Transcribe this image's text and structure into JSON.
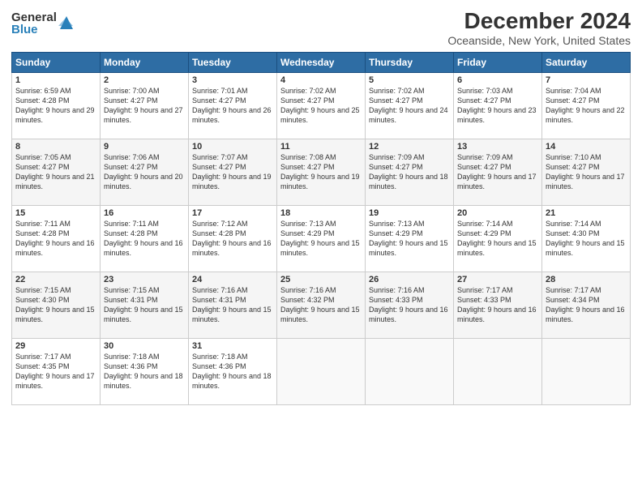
{
  "logo": {
    "general": "General",
    "blue": "Blue"
  },
  "title": "December 2024",
  "subtitle": "Oceanside, New York, United States",
  "header": {
    "days": [
      "Sunday",
      "Monday",
      "Tuesday",
      "Wednesday",
      "Thursday",
      "Friday",
      "Saturday"
    ]
  },
  "weeks": [
    [
      {
        "day": "1",
        "sunrise": "6:59 AM",
        "sunset": "4:28 PM",
        "daylight": "9 hours and 29 minutes."
      },
      {
        "day": "2",
        "sunrise": "7:00 AM",
        "sunset": "4:27 PM",
        "daylight": "9 hours and 27 minutes."
      },
      {
        "day": "3",
        "sunrise": "7:01 AM",
        "sunset": "4:27 PM",
        "daylight": "9 hours and 26 minutes."
      },
      {
        "day": "4",
        "sunrise": "7:02 AM",
        "sunset": "4:27 PM",
        "daylight": "9 hours and 25 minutes."
      },
      {
        "day": "5",
        "sunrise": "7:02 AM",
        "sunset": "4:27 PM",
        "daylight": "9 hours and 24 minutes."
      },
      {
        "day": "6",
        "sunrise": "7:03 AM",
        "sunset": "4:27 PM",
        "daylight": "9 hours and 23 minutes."
      },
      {
        "day": "7",
        "sunrise": "7:04 AM",
        "sunset": "4:27 PM",
        "daylight": "9 hours and 22 minutes."
      }
    ],
    [
      {
        "day": "8",
        "sunrise": "7:05 AM",
        "sunset": "4:27 PM",
        "daylight": "9 hours and 21 minutes."
      },
      {
        "day": "9",
        "sunrise": "7:06 AM",
        "sunset": "4:27 PM",
        "daylight": "9 hours and 20 minutes."
      },
      {
        "day": "10",
        "sunrise": "7:07 AM",
        "sunset": "4:27 PM",
        "daylight": "9 hours and 19 minutes."
      },
      {
        "day": "11",
        "sunrise": "7:08 AM",
        "sunset": "4:27 PM",
        "daylight": "9 hours and 19 minutes."
      },
      {
        "day": "12",
        "sunrise": "7:09 AM",
        "sunset": "4:27 PM",
        "daylight": "9 hours and 18 minutes."
      },
      {
        "day": "13",
        "sunrise": "7:09 AM",
        "sunset": "4:27 PM",
        "daylight": "9 hours and 17 minutes."
      },
      {
        "day": "14",
        "sunrise": "7:10 AM",
        "sunset": "4:27 PM",
        "daylight": "9 hours and 17 minutes."
      }
    ],
    [
      {
        "day": "15",
        "sunrise": "7:11 AM",
        "sunset": "4:28 PM",
        "daylight": "9 hours and 16 minutes."
      },
      {
        "day": "16",
        "sunrise": "7:11 AM",
        "sunset": "4:28 PM",
        "daylight": "9 hours and 16 minutes."
      },
      {
        "day": "17",
        "sunrise": "7:12 AM",
        "sunset": "4:28 PM",
        "daylight": "9 hours and 16 minutes."
      },
      {
        "day": "18",
        "sunrise": "7:13 AM",
        "sunset": "4:29 PM",
        "daylight": "9 hours and 15 minutes."
      },
      {
        "day": "19",
        "sunrise": "7:13 AM",
        "sunset": "4:29 PM",
        "daylight": "9 hours and 15 minutes."
      },
      {
        "day": "20",
        "sunrise": "7:14 AM",
        "sunset": "4:29 PM",
        "daylight": "9 hours and 15 minutes."
      },
      {
        "day": "21",
        "sunrise": "7:14 AM",
        "sunset": "4:30 PM",
        "daylight": "9 hours and 15 minutes."
      }
    ],
    [
      {
        "day": "22",
        "sunrise": "7:15 AM",
        "sunset": "4:30 PM",
        "daylight": "9 hours and 15 minutes."
      },
      {
        "day": "23",
        "sunrise": "7:15 AM",
        "sunset": "4:31 PM",
        "daylight": "9 hours and 15 minutes."
      },
      {
        "day": "24",
        "sunrise": "7:16 AM",
        "sunset": "4:31 PM",
        "daylight": "9 hours and 15 minutes."
      },
      {
        "day": "25",
        "sunrise": "7:16 AM",
        "sunset": "4:32 PM",
        "daylight": "9 hours and 15 minutes."
      },
      {
        "day": "26",
        "sunrise": "7:16 AM",
        "sunset": "4:33 PM",
        "daylight": "9 hours and 16 minutes."
      },
      {
        "day": "27",
        "sunrise": "7:17 AM",
        "sunset": "4:33 PM",
        "daylight": "9 hours and 16 minutes."
      },
      {
        "day": "28",
        "sunrise": "7:17 AM",
        "sunset": "4:34 PM",
        "daylight": "9 hours and 16 minutes."
      }
    ],
    [
      {
        "day": "29",
        "sunrise": "7:17 AM",
        "sunset": "4:35 PM",
        "daylight": "9 hours and 17 minutes."
      },
      {
        "day": "30",
        "sunrise": "7:18 AM",
        "sunset": "4:36 PM",
        "daylight": "9 hours and 18 minutes."
      },
      {
        "day": "31",
        "sunrise": "7:18 AM",
        "sunset": "4:36 PM",
        "daylight": "9 hours and 18 minutes."
      },
      null,
      null,
      null,
      null
    ]
  ],
  "labels": {
    "sunrise": "Sunrise:",
    "sunset": "Sunset:",
    "daylight": "Daylight:"
  }
}
